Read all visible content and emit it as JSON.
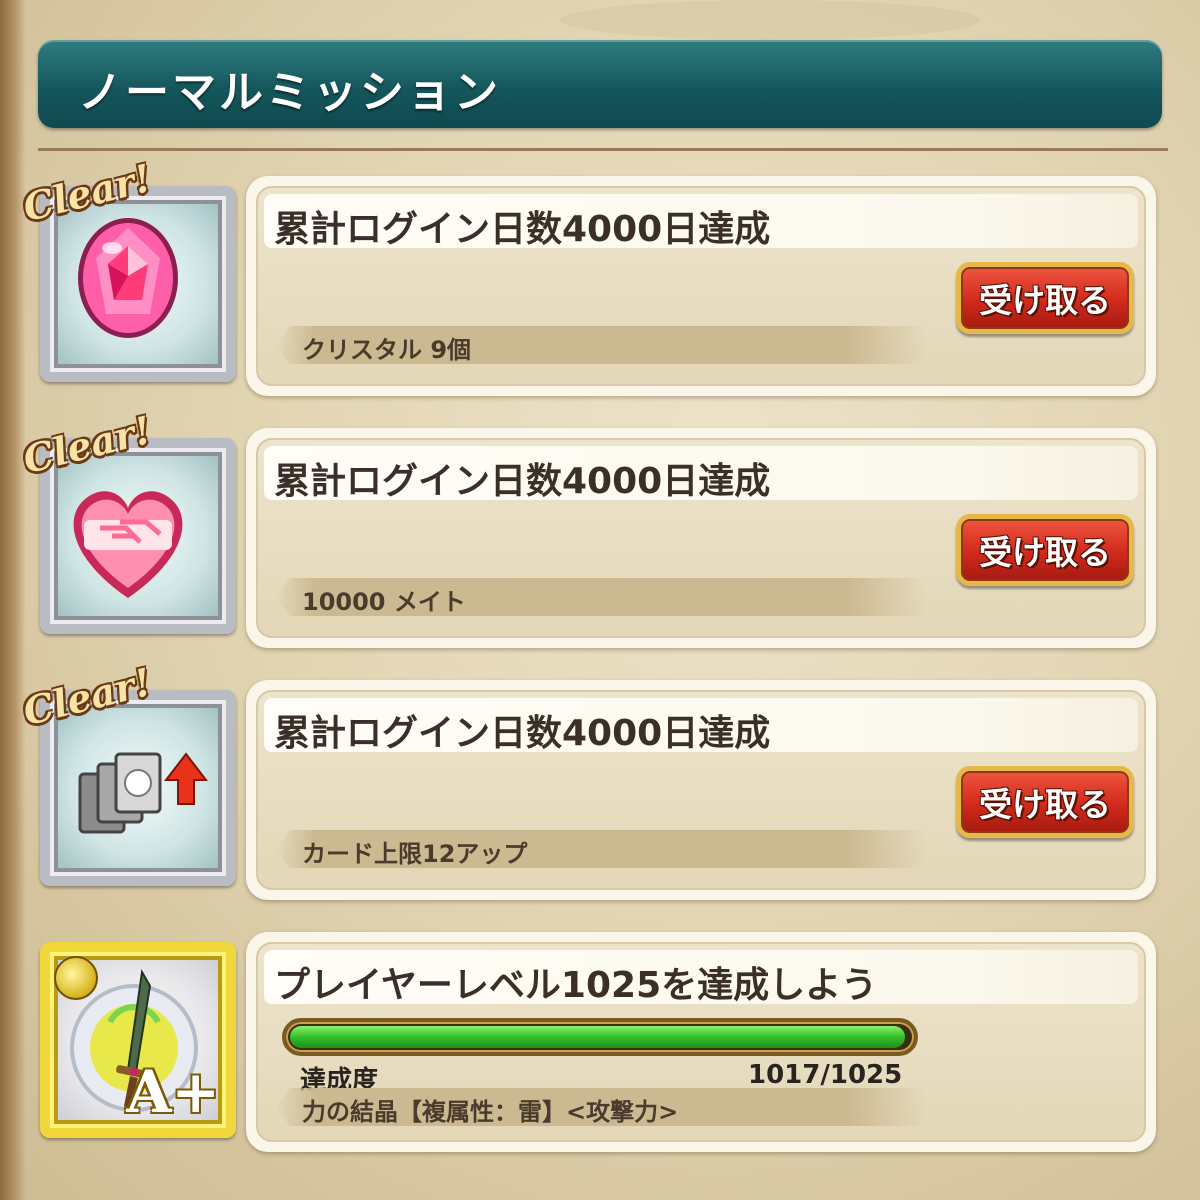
{
  "header": {
    "title": "ノーマルミッション"
  },
  "missions": [
    {
      "status": "Clear!",
      "icon": "pink-crystal-gem-icon",
      "title": "累計ログイン日数4000日達成",
      "reward": "クリスタル 9個",
      "button_label": "受け取る"
    },
    {
      "status": "Clear!",
      "icon": "handshake-heart-icon",
      "title": "累計ログイン日数4000日達成",
      "reward": "10000 メイト",
      "button_label": "受け取る"
    },
    {
      "status": "Clear!",
      "icon": "card-limit-up-icon",
      "title": "累計ログイン日数4000日達成",
      "reward": "カード上限12アップ",
      "button_label": "受け取る"
    },
    {
      "icon": "sword-crystal-icon",
      "rank": "A+",
      "title": "プレイヤーレベル1025を達成しよう",
      "progress_label": "達成度",
      "progress_text": "1017/1025",
      "progress_fraction": 0.992,
      "reward": "力の結晶【複属性：雷】<攻撃力>"
    }
  ],
  "colors": {
    "header": "#15575c",
    "claim_button": "#d12a1c",
    "progress_fill": "#33c02a"
  }
}
